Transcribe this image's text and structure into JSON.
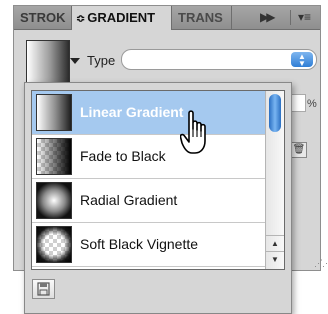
{
  "tabs": [
    {
      "label": "STROK"
    },
    {
      "label": "GRADIENT",
      "prefix": "≎"
    },
    {
      "label": "TRANS"
    }
  ],
  "panel_menu": {
    "forward_icon": "ffwd-icon",
    "menu_icon": "panel-menu-icon"
  },
  "controls": {
    "type_label": "Type",
    "type_value": "",
    "percent_symbol": "%"
  },
  "preset_list": [
    {
      "name": "Linear Gradient",
      "icon": "linear-gradient-swatch",
      "selected": true
    },
    {
      "name": "Fade to Black",
      "icon": "fade-to-black-swatch",
      "selected": false
    },
    {
      "name": "Radial Gradient",
      "icon": "radial-gradient-swatch",
      "selected": false
    },
    {
      "name": "Soft Black Vignette",
      "icon": "soft-black-vignette-swatch",
      "selected": false
    }
  ],
  "colors": {
    "selection_highlight": "#a5c9ef",
    "scroll_thumb": "#4a90e2",
    "panel_bg": "#d6d6d6"
  }
}
